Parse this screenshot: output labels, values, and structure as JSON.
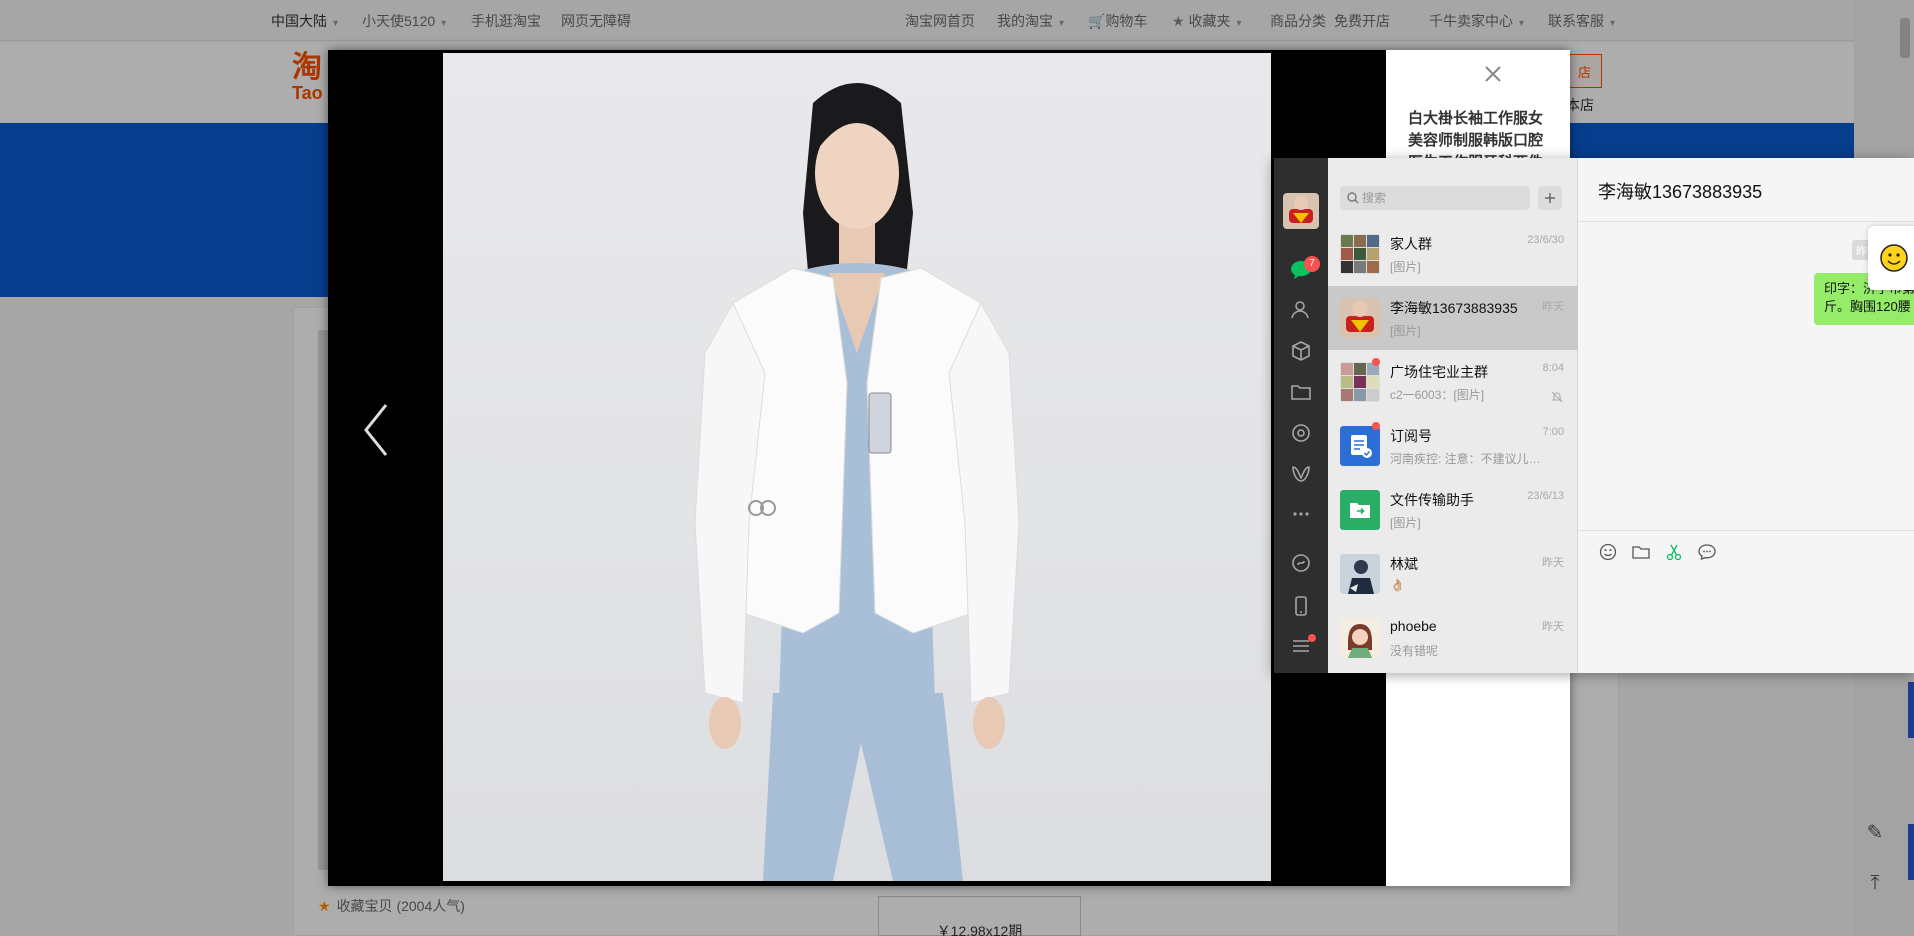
{
  "topbar": {
    "region": "中国大陆",
    "user": "小天使5120",
    "mobile": "手机逛淘宝",
    "accessibility": "网页无障碍",
    "home": "淘宝网首页",
    "my_taobao": "我的淘宝",
    "cart": "购物车",
    "favorites": "收藏夹",
    "categories": "商品分类",
    "open_shop": "免费开店",
    "seller_center": "千牛卖家中心",
    "contact": "联系客服"
  },
  "header": {
    "logo_cn": "淘",
    "logo_en": "Tao",
    "shop_button": "店",
    "shop_link": "本店"
  },
  "product": {
    "favorite_label": "收藏宝贝 (2004人气)",
    "installment": "￥12.98x12期"
  },
  "lightbox": {
    "title": "白大褂长袖工作服女美容师制服韩版口腔医生工作服牙科两件"
  },
  "wechat": {
    "search_placeholder": "搜索",
    "unread_badge": "7",
    "chats": [
      {
        "name": "家人群",
        "time": "23/6/30",
        "preview": "[图片]",
        "avatar": "grid"
      },
      {
        "name": "李海敏13673883935",
        "time": "昨天",
        "preview": "[图片]",
        "avatar": "mask"
      },
      {
        "name": "广场住宅业主群",
        "time": "8:04",
        "preview": "c2一6003：[图片]",
        "avatar": "grid2"
      },
      {
        "name": "订阅号",
        "time": "7:00",
        "preview": "河南疾控: 注意：不建议儿童...",
        "avatar": "blue"
      },
      {
        "name": "文件传输助手",
        "time": "23/6/13",
        "preview": "[图片]",
        "avatar": "green"
      },
      {
        "name": "林斌",
        "time": "昨天",
        "preview": "👌🏼",
        "avatar": "person"
      },
      {
        "name": "phoebe",
        "time": "昨天",
        "preview": "没有错呢",
        "avatar": "girl"
      }
    ],
    "conversation_title": "李海敏13673883935",
    "time_chip": "昨天",
    "message": "印字：济宁市第\n斤。胸围120腰"
  },
  "colors": {
    "accent_orange": "#ff5000",
    "banner_blue": "#0a5bd0",
    "wechat_green": "#95ec69",
    "badge_red": "#fa5151"
  }
}
